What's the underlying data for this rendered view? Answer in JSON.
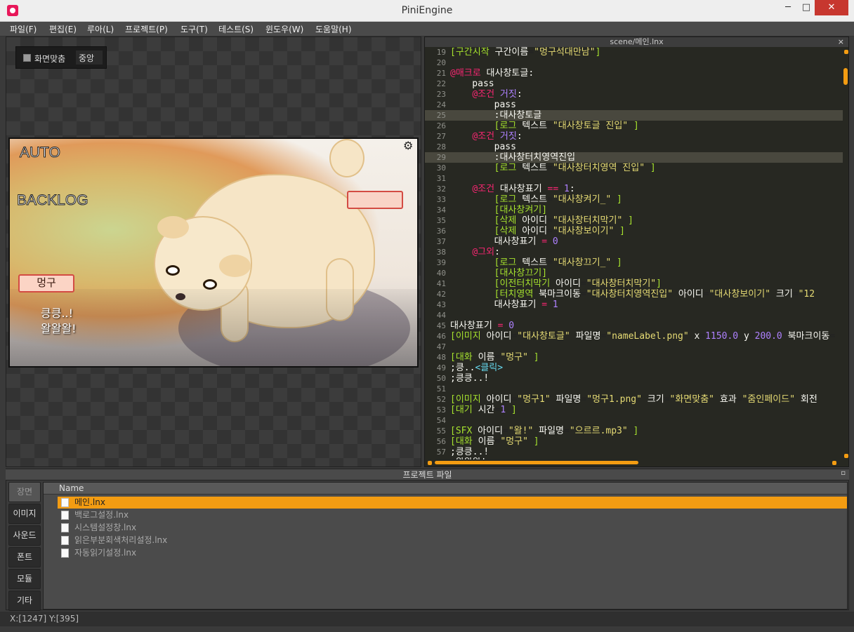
{
  "window": {
    "title": "PiniEngine",
    "minimize": "─",
    "maximize": "□",
    "close": "✕"
  },
  "menu": [
    "파일(F)",
    "편집(E)",
    "루아(L)",
    "프로젝트(P)",
    "도구(T)",
    "테스트(S)",
    "윈도우(W)",
    "도움말(H)"
  ],
  "preview": {
    "fit_label": "화면맞춤",
    "align_value": "중앙",
    "scene": {
      "auto": "AUTO",
      "backlog": "BACKLOG",
      "speaker": "멍구",
      "dialog_line1": "킁킁..!",
      "dialog_line2": "왈왈왈!"
    }
  },
  "editor": {
    "tab_title": "scene/메인.lnx",
    "close": "×"
  },
  "project_panel": {
    "title": "프로젝트 파일",
    "dock": "▫",
    "categories": [
      "장면",
      "이미지",
      "사운드",
      "폰트",
      "모듈",
      "기타"
    ],
    "column_name": "Name",
    "files": [
      "메인.lnx",
      "백로그설정.lnx",
      "시스템설정창.lnx",
      "읽은부분회색처리설정.lnx",
      "자동읽기설정.lnx"
    ]
  },
  "status": {
    "coords": "X:[1247] Y:[395]"
  },
  "colors": {
    "accent": "#f39c12",
    "editor_bg": "#272822",
    "keyword": "#f92672",
    "bracket": "#a6e22e",
    "string": "#e6db74",
    "number": "#ae81ff"
  }
}
